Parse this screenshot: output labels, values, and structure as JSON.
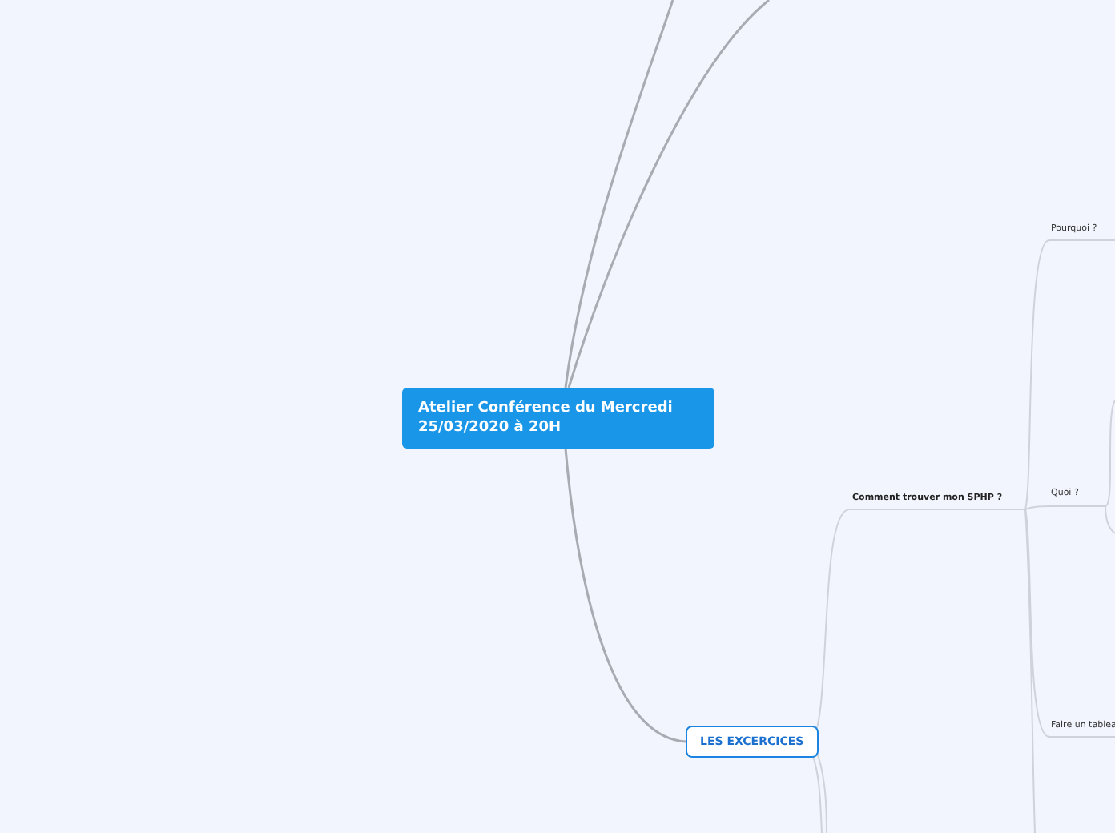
{
  "mind_map": {
    "central_topic": "Atelier Conférence du Mercredi 25/03/2020 à 20H",
    "branches": [
      {
        "label": "LES EXCERCICES",
        "children": [
          {
            "label": "Comment trouver mon SPHP ?",
            "children": [
              {
                "label": "Pourquoi ?"
              },
              {
                "label": "Quoi ?"
              },
              {
                "label": "Faire un tablea"
              }
            ]
          }
        ]
      }
    ]
  }
}
